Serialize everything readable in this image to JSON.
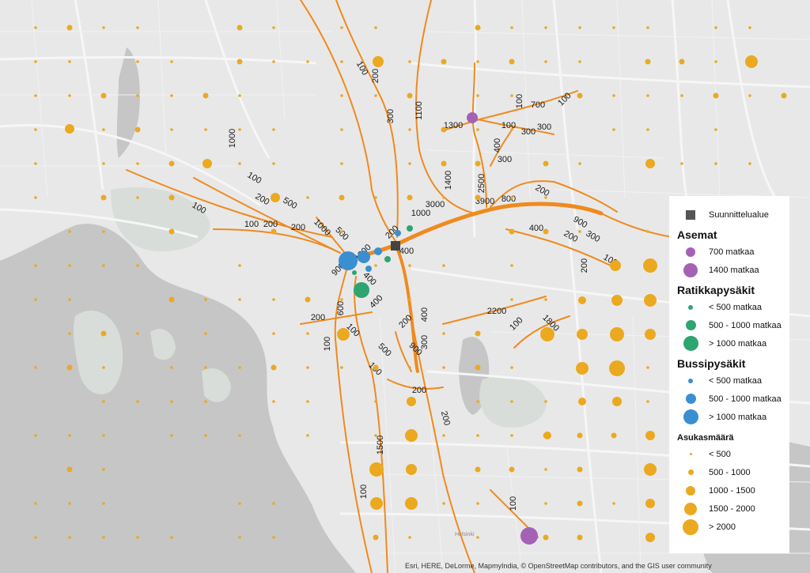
{
  "map": {
    "colors": {
      "water": "#c6c6c6",
      "land": "#e8e8e8",
      "green": "#d9ddd9",
      "street": "#f6f6f6",
      "route": "#ef8a1f",
      "resident": "#eba91f",
      "station": "#a562b5",
      "tram": "#2ea471",
      "bus": "#3a8fd1",
      "planning_area": "#444444"
    },
    "place_labels": [
      "Helsinki"
    ],
    "flow_labels": [
      "100",
      "200",
      "300",
      "1000",
      "100",
      "200",
      "500",
      "100",
      "100",
      "200",
      "200",
      "500",
      "1000",
      "900",
      "400",
      "1300",
      "200",
      "400",
      "1000",
      "3000",
      "3900",
      "2500",
      "1400",
      "1100",
      "1300",
      "100",
      "700",
      "100",
      "100",
      "300",
      "300",
      "400",
      "300",
      "800",
      "200",
      "400",
      "200",
      "900",
      "300",
      "200",
      "100",
      "200",
      "100",
      "600",
      "100",
      "500",
      "100",
      "200",
      "400",
      "900",
      "200",
      "100",
      "400",
      "300",
      "2200",
      "1800",
      "200",
      "1500",
      "100",
      "100",
      "1400"
    ]
  },
  "legend": {
    "planning_area": "Suunnittelualue",
    "stations_title": "Asemat",
    "stations": [
      "700 matkaa",
      "1400 matkaa"
    ],
    "tram_title": "Ratikkapysäkit",
    "tram": [
      "< 500 matkaa",
      "500 - 1000 matkaa",
      "> 1000 matkaa"
    ],
    "bus_title": "Bussipysäkit",
    "bus": [
      "< 500 matkaa",
      "500 - 1000 matkaa",
      "> 1000 matkaa"
    ],
    "pop_title": "Asukasmäärä",
    "pop": [
      "< 500",
      "500 - 1000",
      "1000 - 1500",
      "1500 - 2000",
      "> 2000"
    ]
  },
  "attribution": "Esri, HERE, DeLorme, MapmyIndia, © OpenStreetMap contributors, and the GIS user community"
}
